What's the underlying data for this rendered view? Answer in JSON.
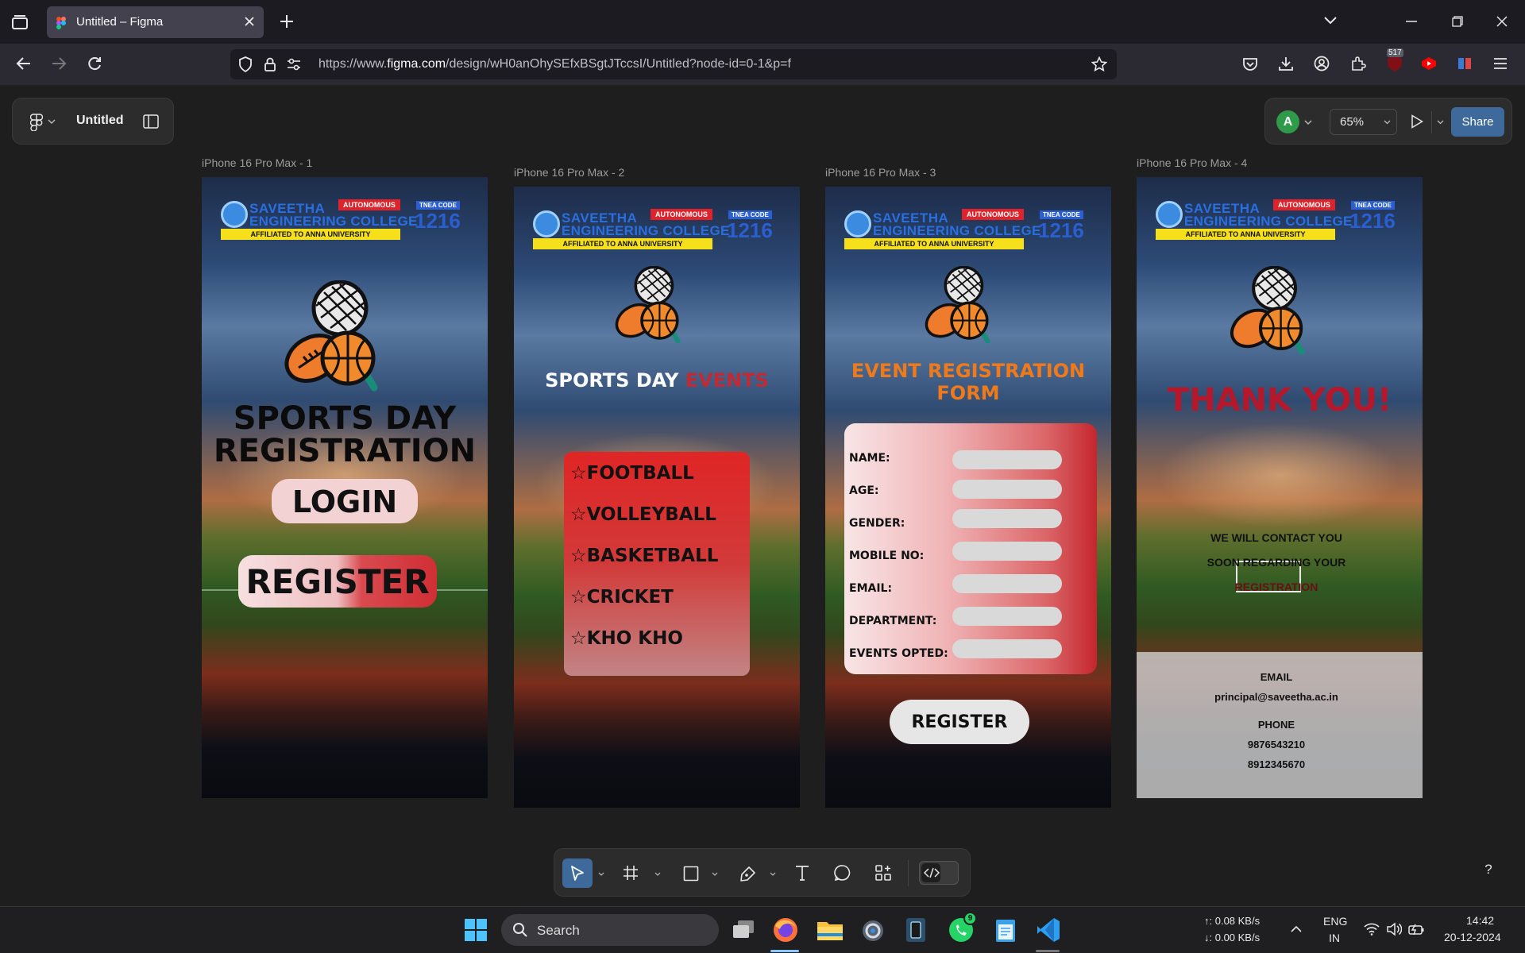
{
  "browser": {
    "tab_title": "Untitled – Figma",
    "url_prefix": "https://www.",
    "url_domain": "figma.com",
    "url_rest": "/design/wH0anOhySEfxBSgtJTccsI/Untitled?node-id=0-1&p=f",
    "extension_badge": "517"
  },
  "figma": {
    "file_name": "Untitled",
    "avatar_letter": "A",
    "zoom": "65%",
    "share_label": "Share",
    "help": "?"
  },
  "frames": [
    {
      "label": "iPhone 16 Pro Max - 1"
    },
    {
      "label": "iPhone 16 Pro Max - 2"
    },
    {
      "label": "iPhone 16 Pro Max - 3"
    },
    {
      "label": "iPhone 16 Pro Max - 4"
    }
  ],
  "college": {
    "name_line1": "SAVEETHA",
    "name_line2": "ENGINEERING COLLEGE",
    "autonomous": "AUTONOMOUS",
    "affiliated": "AFFILIATED TO ANNA UNIVERSITY",
    "tnea_label": "TNEA CODE",
    "tnea_code": "1216"
  },
  "screen1": {
    "title_line1": "SPORTS DAY",
    "title_line2": "REGISTRATION",
    "login": "LOGIN",
    "register": "REGISTER"
  },
  "screen2": {
    "title_a": "SPORTS DAY",
    "title_b": "EVENTS",
    "events": [
      "☆FOOTBALL",
      "☆VOLLEYBALL",
      "☆BASKETBALL",
      "☆CRICKET",
      "☆KHO KHO"
    ]
  },
  "screen3": {
    "title_line1": "EVENT REGISTRATION",
    "title_line2": "FORM",
    "fields": [
      "NAME:",
      "AGE:",
      "GENDER:",
      "MOBILE NO:",
      "EMAIL:",
      "DEPARTMENT:",
      "EVENTS OPTED:"
    ],
    "register": "REGISTER"
  },
  "screen4": {
    "title": "THANK YOU!",
    "message_line1": "WE WILL CONTACT YOU",
    "message_line2": "SOON REGARDING YOUR",
    "message_line3": "REGISTRATION",
    "email_label": "EMAIL",
    "email": "principal@saveetha.ac.in",
    "phone_label": "PHONE",
    "phone1": "9876543210",
    "phone2": "8912345670"
  },
  "taskbar": {
    "search": "Search",
    "whatsapp_badge": "9",
    "net_up": "↑: 0.08 KB/s",
    "net_down": "↓: 0.00 KB/s",
    "lang1": "ENG",
    "lang2": "IN",
    "time": "14:42",
    "date": "20-12-2024"
  },
  "colors": {
    "accent": "#3d6a9a",
    "title_orange": "#f07a1a",
    "thank_red": "#b5172b"
  }
}
